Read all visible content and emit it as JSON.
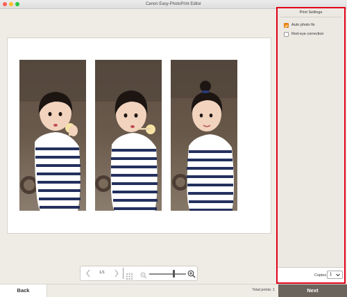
{
  "window": {
    "title": "Canon Easy-PhotoPrint Editor"
  },
  "preview": {
    "photos": [
      {
        "name": "photo-1",
        "description_icon": "child-with-ice-cream-photo"
      },
      {
        "name": "photo-2",
        "description_icon": "child-with-ice-cream-photo"
      },
      {
        "name": "photo-3",
        "description_icon": "child-portrait-photo"
      }
    ]
  },
  "navigation": {
    "prev_icon": "chevron-left-icon",
    "next_icon": "chevron-right-icon",
    "page_indicator": "1/1",
    "grid_icon": "grid-view-icon",
    "zoom_out_icon": "zoom-out-icon",
    "zoom_in_icon": "zoom-in-icon",
    "zoom_level": 0.67
  },
  "settings_panel": {
    "title": "Print Settings",
    "options": [
      {
        "label": "Auto photo fix",
        "checked": true
      },
      {
        "label": "Red-eye correction",
        "checked": false
      }
    ],
    "copies_label": "Copies",
    "copies_value": "1"
  },
  "bottom_bar": {
    "back_label": "Back",
    "total_prints": "Total prints: 1",
    "next_label": "Next"
  },
  "colors": {
    "accent_orange": "#f08c1a",
    "highlight_red": "#e0001a",
    "next_button": "#6b645c",
    "background": "#efece6"
  }
}
